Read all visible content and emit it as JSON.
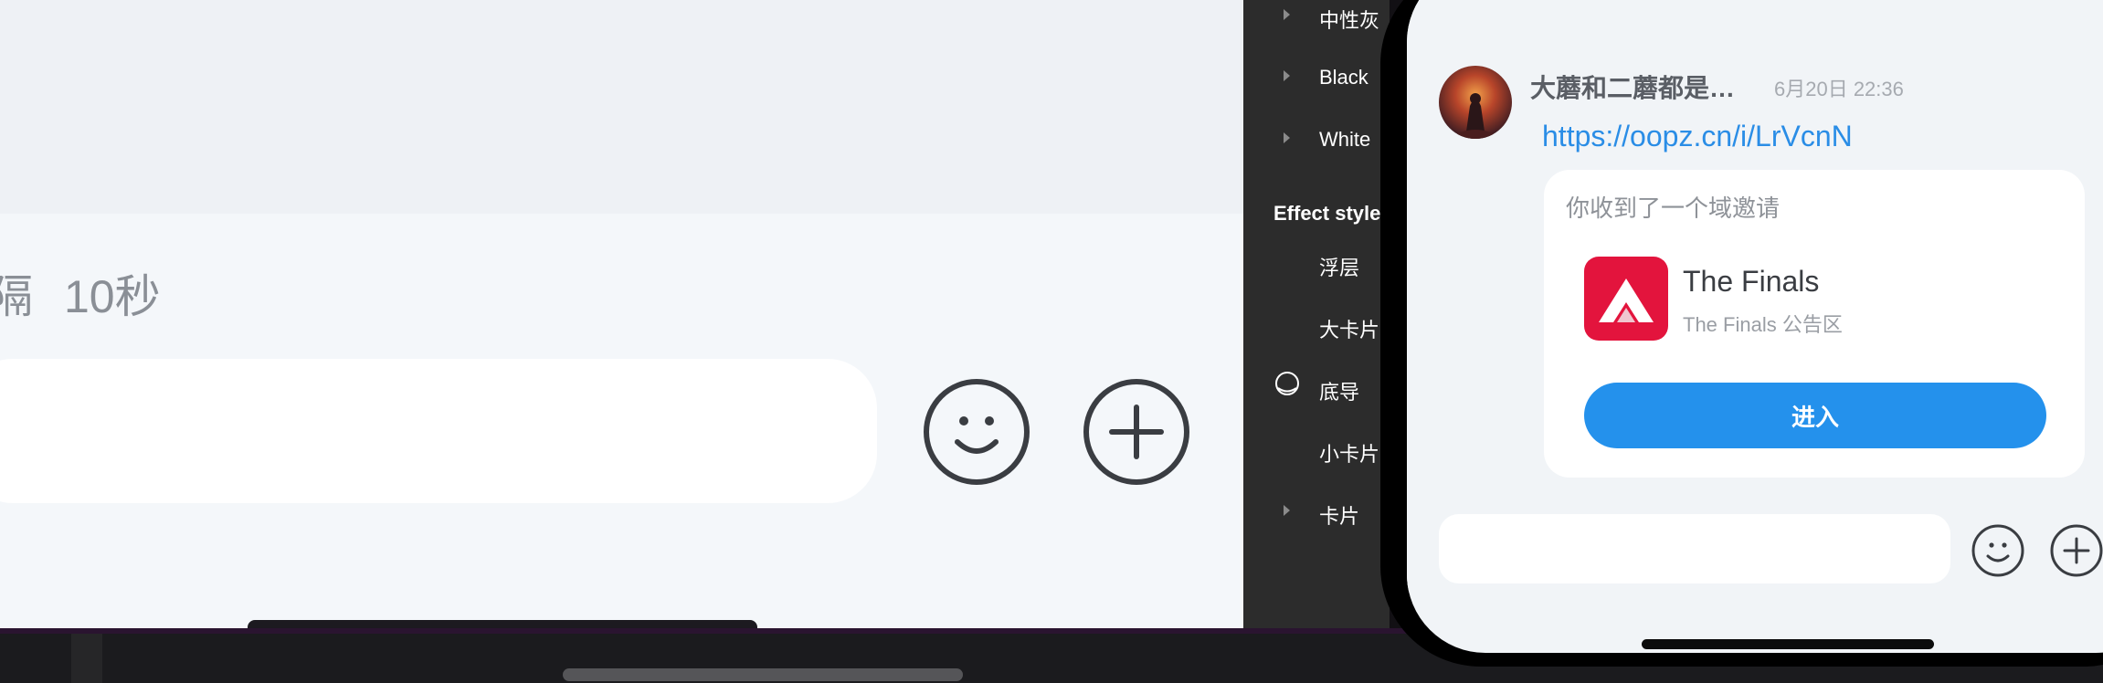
{
  "left_chat": {
    "status_partial": "隔",
    "duration": "10秒",
    "emoji_button": "emoji-icon",
    "plus_button": "plus-icon"
  },
  "panel": {
    "items_top": [
      {
        "label": "中性灰",
        "expandable": true
      },
      {
        "label": "Black",
        "expandable": true
      },
      {
        "label": "White",
        "expandable": true
      }
    ],
    "section_title": "Effect styles",
    "effect_items": [
      {
        "label": "浮层",
        "expandable": false,
        "icon": ""
      },
      {
        "label": "大卡片",
        "expandable": false,
        "icon": ""
      },
      {
        "label": "底导",
        "expandable": false,
        "icon": "circle-icon"
      },
      {
        "label": "小卡片",
        "expandable": false,
        "icon": ""
      },
      {
        "label": "卡片",
        "expandable": true,
        "icon": ""
      }
    ]
  },
  "phone": {
    "message": {
      "sender": "大蘑和二蘑都是…",
      "time": "6月20日 22:36",
      "link": "https://oopz.cn/i/LrVcnN"
    },
    "invite": {
      "title": "你收到了一个域邀请",
      "app_name": "The Finals",
      "app_sub": "The Finals 公告区",
      "button": "进入"
    },
    "input_placeholder": ""
  },
  "colors": {
    "accent": "#2491ec",
    "link": "#2a8de6",
    "app_logo": "#e3143d",
    "panel_bg": "#2c2c2c"
  }
}
